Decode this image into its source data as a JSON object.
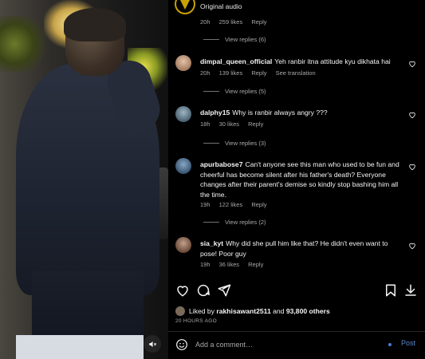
{
  "header": {
    "audio_label": "Original audio"
  },
  "top_comment_meta": {
    "time": "20h",
    "likes": "259 likes",
    "reply": "Reply"
  },
  "comments": [
    {
      "view_replies_before": "View replies (6)",
      "username": "dimpal_queen_official",
      "text": "Yeh ranbir itna attitude kyu dikhata hai",
      "time": "20h",
      "likes": "139 likes",
      "reply": "Reply",
      "translate": "See translation",
      "avatar_color": "#c8a98c",
      "view_replies_after": "View replies (5)"
    },
    {
      "username": "dalphy15",
      "text": "Why is ranbir always angry ???",
      "time": "18h",
      "likes": "30 likes",
      "reply": "Reply",
      "avatar_color": "#6f8a9c",
      "view_replies_after": "View replies (3)"
    },
    {
      "username": "apurbabose7",
      "text": "Can't anyone see this man who used to be fun and cheerful has become silent after his father's death? Everyone changes after their parent's demise so kindly stop bashing him all the time.",
      "time": "19h",
      "likes": "122 likes",
      "reply": "Reply",
      "avatar_color": "#5c7a9a",
      "view_replies_after": "View replies (2)"
    },
    {
      "username": "sia_kyt",
      "text": "Why did she pull him like that? He didn't even want to pose! Poor guy",
      "time": "19h",
      "likes": "36 likes",
      "reply": "Reply",
      "avatar_color": "#8a6a58"
    }
  ],
  "likes_summary": {
    "prefix": "Liked by ",
    "user": "rakhisawant2511",
    "middle": " and ",
    "count": "93,800 others"
  },
  "timestamp": "20 HOURS AGO",
  "add_comment": {
    "placeholder": "Add a comment…",
    "post_label": "Post"
  },
  "colors": {
    "accent_link": "#5b86c9",
    "muted_text": "#a8a8a8",
    "brand_ring": "#c9a100"
  }
}
